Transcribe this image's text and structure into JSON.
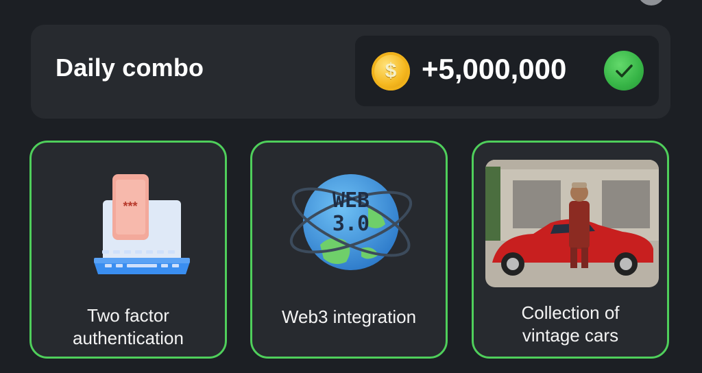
{
  "combo": {
    "title": "Daily combo",
    "reward": "+5,000,000",
    "coin_symbol": "$",
    "completed": true
  },
  "cards": [
    {
      "label": "Two factor authentication",
      "icon": "laptop-phone-password-icon"
    },
    {
      "label": "Web3 integration",
      "icon": "web3-globe-icon",
      "badge": [
        "WEB",
        "3.0"
      ]
    },
    {
      "label": "Collection of vintage cars",
      "icon": "vintage-car-photo"
    }
  ],
  "colors": {
    "background": "#1c1f24",
    "panel": "#272a2f",
    "accent_green": "#4fcf5b",
    "coin_gold": "#f5b81f"
  }
}
